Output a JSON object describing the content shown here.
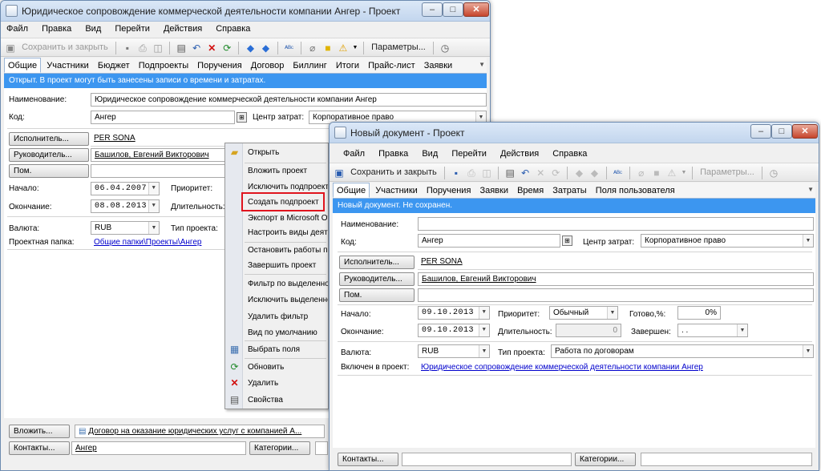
{
  "bg_window": {
    "title": "Юридическое сопровождение коммерческой деятельности компании Ангер - Проект",
    "win_buttons": [
      "–",
      "□",
      "✕"
    ],
    "menu": [
      "Файл",
      "Правка",
      "Вид",
      "Перейти",
      "Действия",
      "Справка"
    ],
    "toolbar": {
      "save_close": "Сохранить и закрыть",
      "params": "Параметры..."
    },
    "tabs": [
      "Общие",
      "Участники",
      "Бюджет",
      "Подпроекты",
      "Поручения",
      "Договор",
      "Биллинг",
      "Итоги",
      "Прайс-лист",
      "Заявки"
    ],
    "status": "Открыт. В проект могут быть занесены записи о времени и затратах.",
    "labels": {
      "name": "Наименование:",
      "code": "Код:",
      "cost_center": "Центр затрат:",
      "start": "Начало:",
      "end": "Окончание:",
      "priority": "Приоритет:",
      "duration": "Длительность:",
      "currency": "Валюта:",
      "project_type": "Тип проекта:",
      "folder": "Проектная папка:"
    },
    "values": {
      "name": "Юридическое сопровождение коммерческой деятельности компании Ангер",
      "code": "Ангер",
      "cost_center": "Корпоративное право",
      "executor": "PER SONA",
      "manager": "Башилов, Евгений Викторович",
      "start": "06.04.2007",
      "end": "08.08.2013",
      "currency": "RUB",
      "folder": "Общие папки\\Проекты\\Ангер"
    },
    "buttons": {
      "executor": "Исполнитель...",
      "manager": "Руководитель...",
      "assistant": "Пом.",
      "attach": "Вложить...",
      "contacts": "Контакты...",
      "categories": "Категории..."
    },
    "attachment": "Договор на оказание юридических услуг с компанией А...",
    "contacts_value": "Ангер"
  },
  "context_menu": {
    "items": [
      {
        "label": "Открыть",
        "icon": "open-folder-icon"
      },
      {
        "label": "Вложить проект",
        "icon": ""
      },
      {
        "label": "Исключить подпроект",
        "icon": ""
      },
      {
        "label": "Создать подпроект",
        "icon": ""
      },
      {
        "label": "Экспорт в Microsoft Office",
        "icon": ""
      },
      {
        "label": "Настроить виды деятельности",
        "icon": ""
      },
      {
        "label": "Остановить работы по проекту",
        "icon": ""
      },
      {
        "label": "Завершить проект",
        "icon": ""
      },
      {
        "label": "Фильтр по выделенному",
        "icon": ""
      },
      {
        "label": "Исключить выделенное",
        "icon": ""
      },
      {
        "label": "Удалить фильтр",
        "icon": ""
      },
      {
        "label": "Вид по умолчанию",
        "icon": ""
      },
      {
        "label": "Выбрать поля",
        "icon": "choose-fields-icon"
      },
      {
        "label": "Обновить",
        "icon": "refresh-icon"
      },
      {
        "label": "Удалить",
        "icon": "delete-icon"
      },
      {
        "label": "Свойства",
        "icon": "properties-icon"
      }
    ],
    "highlight_color": "#e0141e"
  },
  "fg_window": {
    "title": "Новый документ - Проект",
    "win_buttons": [
      "–",
      "□",
      "✕"
    ],
    "menu": [
      "Файл",
      "Правка",
      "Вид",
      "Перейти",
      "Действия",
      "Справка"
    ],
    "toolbar": {
      "save_close": "Сохранить и закрыть",
      "params": "Параметры..."
    },
    "tabs": [
      "Общие",
      "Участники",
      "Поручения",
      "Заявки",
      "Время",
      "Затраты",
      "Поля пользователя"
    ],
    "status": "Новый документ. Не сохранен.",
    "labels": {
      "name": "Наименование:",
      "code": "Код:",
      "cost_center": "Центр затрат:",
      "start": "Начало:",
      "end": "Окончание:",
      "priority": "Приоритет:",
      "duration": "Длительность:",
      "ready": "Готово,%:",
      "finished": "Завершен:",
      "currency": "Валюта:",
      "project_type": "Тип проекта:",
      "included_in": "Включен в проект:"
    },
    "values": {
      "name": "",
      "code": "Ангер",
      "cost_center": "Корпоративное право",
      "executor": "PER SONA",
      "manager": "Башилов, Евгений Викторович",
      "start": "09.10.2013",
      "end": "09.10.2013",
      "priority": "Обычный",
      "duration": "0",
      "ready": "0%",
      "finished": ".   .",
      "currency": "RUB",
      "project_type": "Работа по договорам",
      "included_in": "Юридическое сопровождение коммерческой деятельности компании Ангер"
    },
    "buttons": {
      "executor": "Исполнитель...",
      "manager": "Руководитель...",
      "assistant": "Пом.",
      "contacts": "Контакты...",
      "categories": "Категории..."
    }
  },
  "colors": {
    "status_bar": "#3c96f0",
    "accent_border": "#6d8bb0"
  }
}
